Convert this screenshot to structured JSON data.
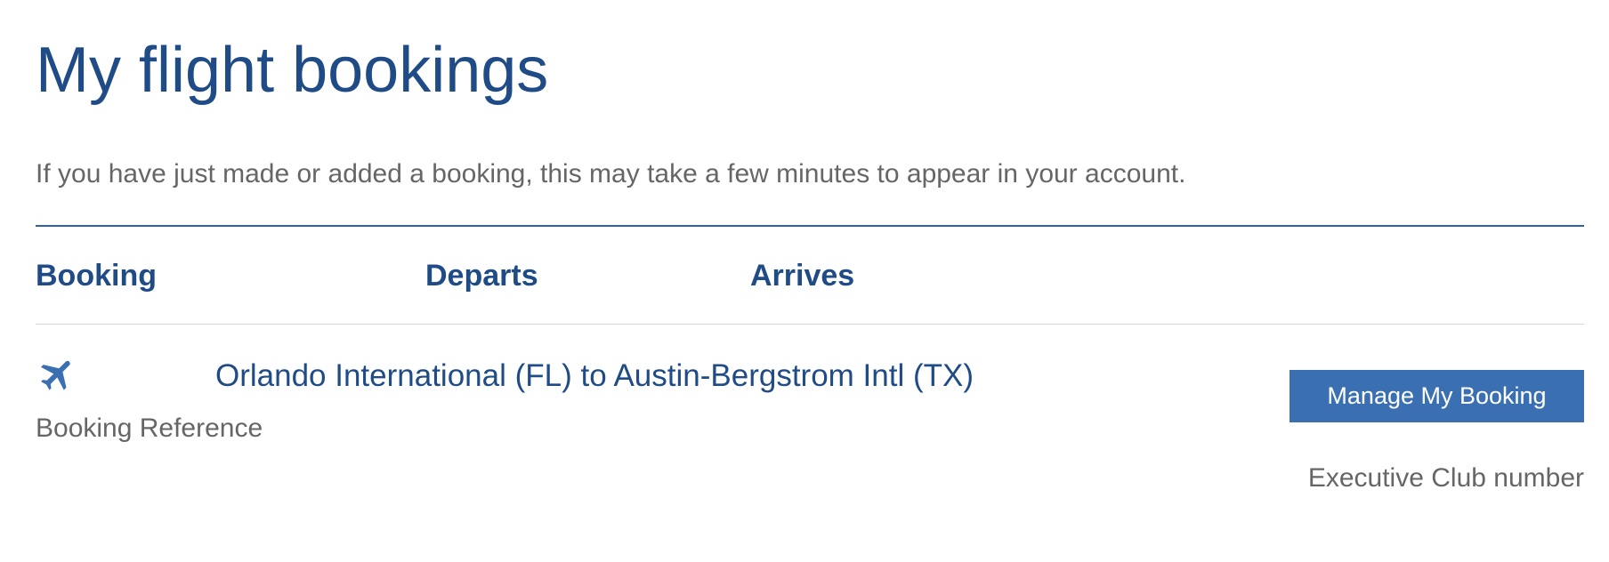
{
  "page": {
    "title": "My flight bookings",
    "notice": "If you have just made or added a booking, this may take a few minutes to appear in your account."
  },
  "table": {
    "headers": {
      "booking": "Booking",
      "departs": "Departs",
      "arrives": "Arrives"
    }
  },
  "bookings": [
    {
      "icon": "plane-icon",
      "route": "Orlando International (FL) to Austin-Bergstrom Intl (TX)",
      "reference_label": "Booking Reference",
      "manage_label": "Manage My Booking",
      "club_label": "Executive Club number"
    }
  ],
  "colors": {
    "heading": "#1f4b87",
    "accent": "#3a70b2",
    "body_text": "#666666",
    "divider": "#d6d6d6"
  }
}
